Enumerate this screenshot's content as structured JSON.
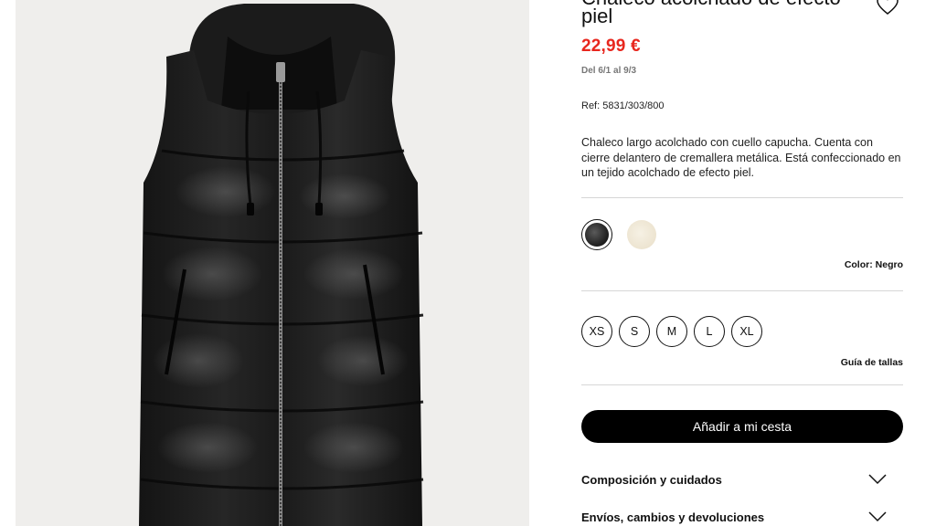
{
  "product": {
    "title": "Chaleco acolchado de efecto piel",
    "price": "22,99 €",
    "dates": "Del 6/1 al 9/3",
    "ref": "Ref: 5831/303/800",
    "description": "Chaleco largo acolchado con cuello capucha. Cuenta con cierre delantero de cremallera metálica. Está confeccionado en un tejido acolchado de efecto piel."
  },
  "colors": {
    "label_prefix": "Color:",
    "selected": "Negro",
    "swatches": [
      {
        "name": "Negro",
        "hex": "#1c1c1c",
        "selected": true
      },
      {
        "name": "Crudo",
        "hex": "#efe6d2",
        "selected": false
      }
    ]
  },
  "sizes": {
    "options": [
      "XS",
      "S",
      "M",
      "L",
      "XL"
    ],
    "guide_label": "Guía de tallas"
  },
  "cart": {
    "add_label": "Añadir a mi cesta"
  },
  "accordion": [
    {
      "label": "Composición y cuidados"
    },
    {
      "label": "Envíos, cambios y devoluciones"
    }
  ],
  "theme": {
    "price_color": "#e8271e",
    "button_bg": "#000000"
  },
  "icons": {
    "favorite": "heart-icon",
    "expand": "chevron-down-icon"
  }
}
